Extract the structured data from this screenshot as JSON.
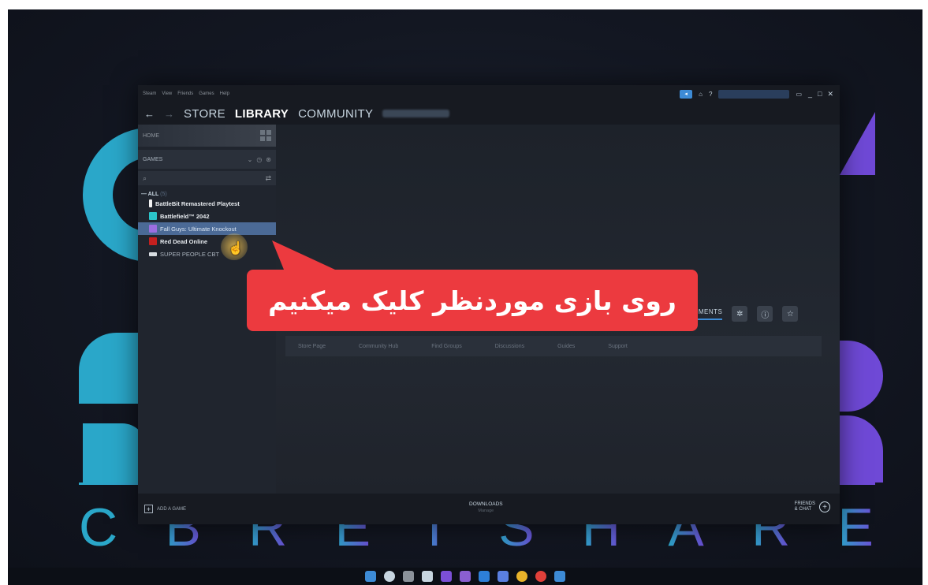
{
  "steam": {
    "menu": [
      "Steam",
      "View",
      "Friends",
      "Games",
      "Help"
    ],
    "titlebar_help": "?",
    "window_controls": [
      "_",
      "□",
      "✕"
    ],
    "nav": {
      "back": "←",
      "forward": "→",
      "tabs": [
        "STORE",
        "LIBRARY",
        "COMMUNITY"
      ]
    },
    "sidebar": {
      "home_label": "HOME",
      "games_label": "GAMES",
      "all_label": "— ALL",
      "all_count": "(5)",
      "games": [
        {
          "name": "BattleBit Remastered Playtest",
          "icon_color": "#f2f2f2"
        },
        {
          "name": "Battlefield™ 2042",
          "icon_color": "#2bc4c9"
        },
        {
          "name": "Fall Guys: Ultimate Knockout",
          "icon_color": "#9b6ee0"
        },
        {
          "name": "Red Dead Online",
          "icon_color": "#c4201f"
        },
        {
          "name": "SUPER PEOPLE CBT",
          "icon_color": "#d8dde2"
        }
      ]
    },
    "main": {
      "achievements_tab": "EMENTS",
      "links": [
        "Store Page",
        "Community Hub",
        "Find Groups",
        "Discussions",
        "Guides",
        "Support"
      ]
    },
    "bottom": {
      "add_game": "ADD A GAME",
      "downloads": "DOWNLOADS",
      "downloads_sub": "Manage",
      "friends_line1": "FRIENDS",
      "friends_line2": "& CHAT"
    }
  },
  "callout": {
    "text": "روی بازی موردنظر کلیک میکنیم",
    "color": "#ec3a3f"
  },
  "background_brand": [
    "C",
    "B",
    "R",
    "E",
    "T",
    "S",
    "H",
    "A",
    "R",
    "E"
  ]
}
